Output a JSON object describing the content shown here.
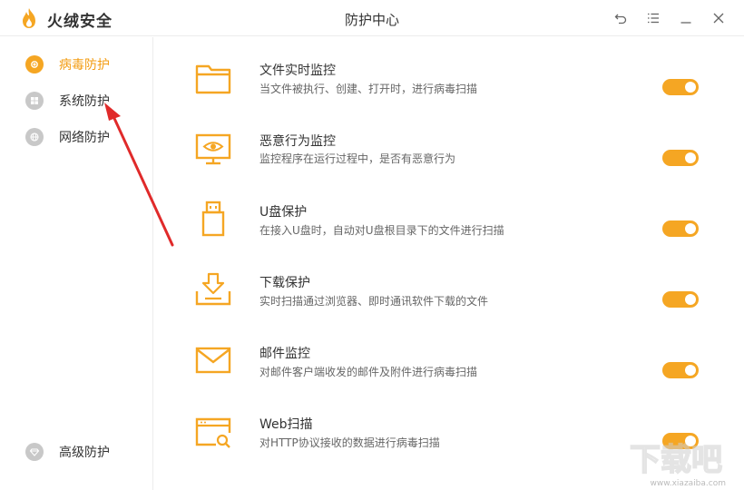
{
  "app": {
    "brand": "火绒安全",
    "title": "防护中心"
  },
  "colors": {
    "accent": "#f5a623",
    "text": "#333333",
    "muted": "#666666",
    "icon_gray": "#c8c8c8"
  },
  "sidebar": {
    "items": [
      {
        "label": "病毒防护",
        "icon": "plus-circle-icon",
        "active": true
      },
      {
        "label": "系统防护",
        "icon": "windows-icon",
        "active": false
      },
      {
        "label": "网络防护",
        "icon": "globe-icon",
        "active": false
      }
    ],
    "bottom": {
      "label": "高级防护",
      "icon": "diamond-icon"
    }
  },
  "items": [
    {
      "title": "文件实时监控",
      "desc": "当文件被执行、创建、打开时，进行病毒扫描",
      "icon": "folder-icon",
      "enabled": true
    },
    {
      "title": "恶意行为监控",
      "desc": "监控程序在运行过程中，是否有恶意行为",
      "icon": "monitor-eye-icon",
      "enabled": true
    },
    {
      "title": "U盘保护",
      "desc": "在接入U盘时，自动对U盘根目录下的文件进行扫描",
      "icon": "usb-drive-icon",
      "enabled": true
    },
    {
      "title": "下载保护",
      "desc": "实时扫描通过浏览器、即时通讯软件下载的文件",
      "icon": "download-tray-icon",
      "enabled": true
    },
    {
      "title": "邮件监控",
      "desc": "对邮件客户端收发的邮件及附件进行病毒扫描",
      "icon": "mail-icon",
      "enabled": true
    },
    {
      "title": "Web扫描",
      "desc": "对HTTP协议接收的数据进行病毒扫描",
      "icon": "browser-search-icon",
      "enabled": true
    }
  ],
  "watermark": {
    "text": "下载吧",
    "sub": "www.xiazaiba.com"
  }
}
